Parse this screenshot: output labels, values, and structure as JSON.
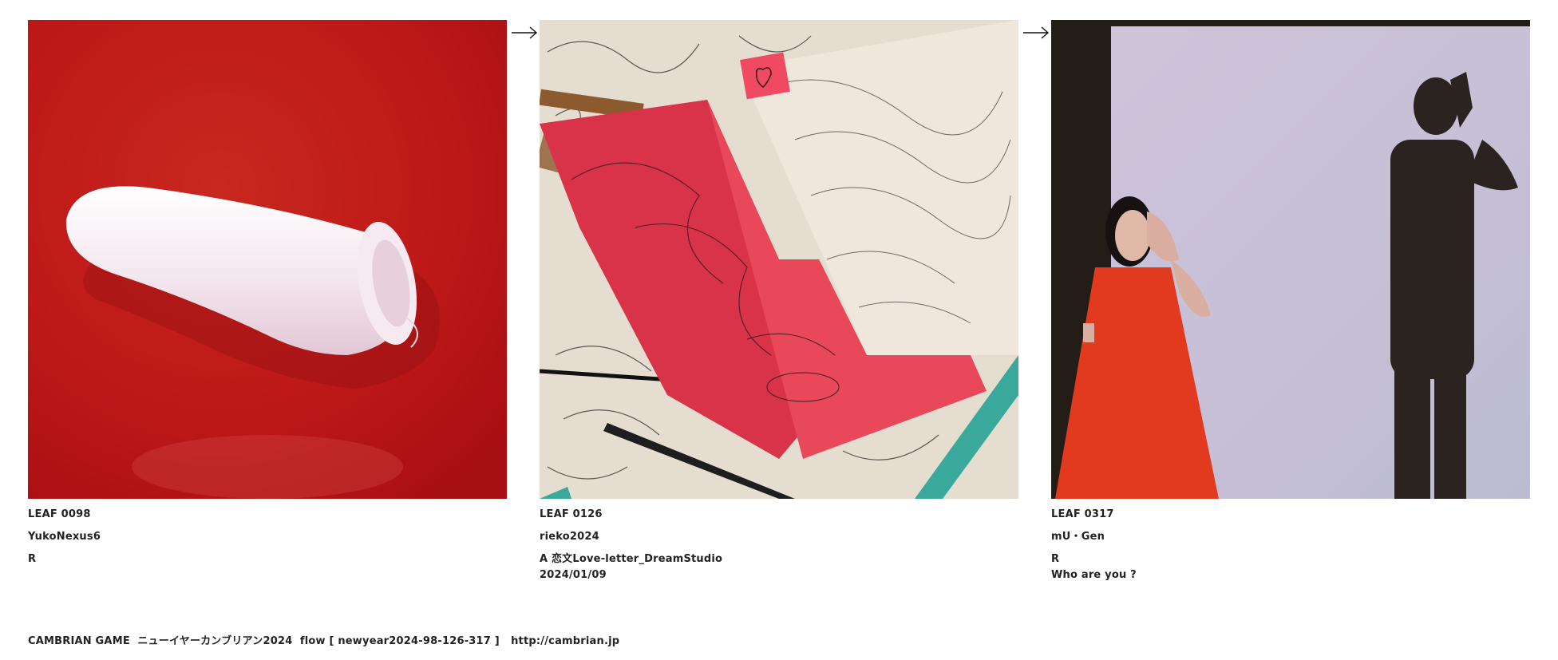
{
  "leaves": [
    {
      "id": "LEAF 0098",
      "author": "YukoNexus6",
      "line1": "R",
      "line2": ""
    },
    {
      "id": "LEAF 0126",
      "author": "rieko2024",
      "line1": "A 恋文Love-letter_DreamStudio",
      "line2": "2024/01/09"
    },
    {
      "id": "LEAF 0317",
      "author": "mU・Gen",
      "line1": "R",
      "line2": "Who are you ?"
    }
  ],
  "footer": {
    "text": "CAMBRIAN GAME  ニューイヤーカンブリアン2024  flow [ newyear2024-98-126-317 ]   http://cambrian.jp"
  },
  "icons": {
    "flow_arrow": "right-arrow-icon"
  },
  "colors": {
    "red_surface": "#c21a1a",
    "towel": "#f1e8ee",
    "paper": "#e9dfd2",
    "pink_paper": "#d9334a",
    "teal_pencil": "#3aa89a",
    "red_dress": "#e23a1f",
    "wall": "#c9c3d6",
    "shadow": "#2a2320"
  }
}
